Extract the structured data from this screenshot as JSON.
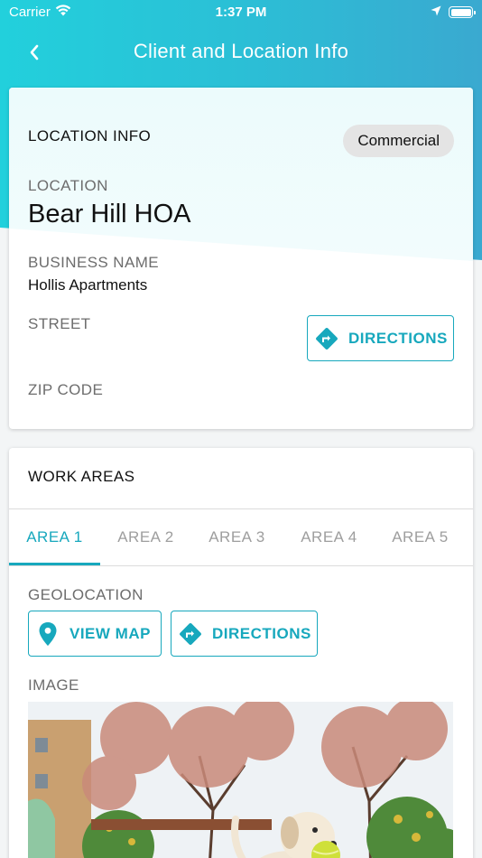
{
  "status_bar": {
    "carrier": "Carrier",
    "time": "1:37 PM"
  },
  "nav": {
    "title": "Client and Location Info"
  },
  "location_card": {
    "section_title": "LOCATION INFO",
    "type_chip": "Commercial",
    "location_label": "LOCATION",
    "location_value": "Bear Hill HOA",
    "business_label": "BUSINESS NAME",
    "business_value": "Hollis Apartments",
    "street_label": "STREET",
    "directions_label": "DIRECTIONS",
    "zip_label": "ZIP CODE"
  },
  "work_areas_card": {
    "section_title": "WORK AREAS",
    "tabs": [
      "AREA 1",
      "AREA 2",
      "AREA 3",
      "AREA 4",
      "AREA 5"
    ],
    "active_tab": 0,
    "geolocation_label": "GEOLOCATION",
    "view_map_label": "VIEW MAP",
    "directions_label": "DIRECTIONS",
    "image_label": "IMAGE"
  },
  "colors": {
    "accent": "#17a8bd",
    "header_gradient_start": "#22d0dc",
    "header_gradient_end": "#3aa9d0"
  },
  "icons": [
    "wifi-icon",
    "location-arrow-icon",
    "battery-icon",
    "back-chevron-icon",
    "directions-icon",
    "map-pin-icon"
  ]
}
